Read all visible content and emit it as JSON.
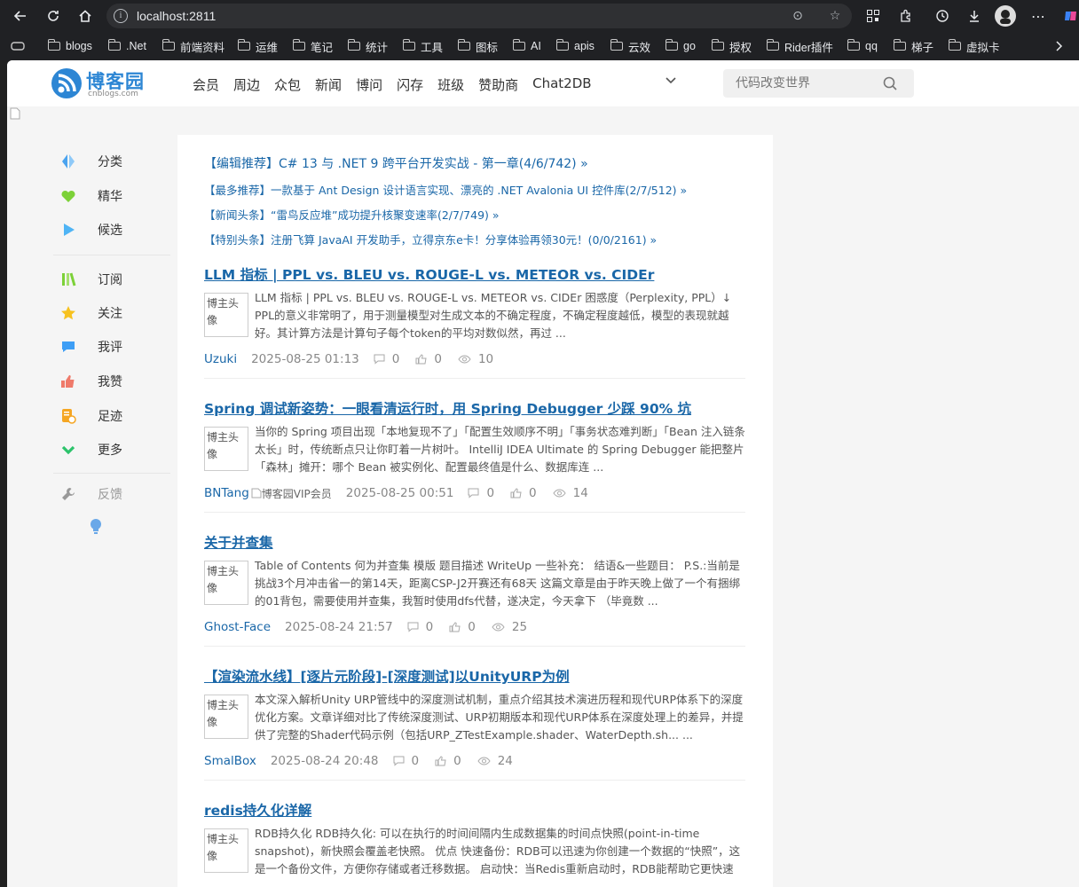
{
  "browser": {
    "url": "localhost:2811",
    "bookmarks": [
      "blogs",
      ".Net",
      "前端资料",
      "运维",
      "笔记",
      "统计",
      "工具",
      "图标",
      "AI",
      "apis",
      "云效",
      "go",
      "授权",
      "Rider插件",
      "qq",
      "梯子",
      "虚拟卡"
    ]
  },
  "site": {
    "logo_text": "博客园",
    "logo_sub": "cnblogs.com",
    "nav": [
      "会员",
      "周边",
      "众包",
      "新闻",
      "博问",
      "闪存",
      "班级",
      "赞助商",
      "Chat2DB"
    ],
    "search_placeholder": "代码改变世界",
    "brand_color": "#2d86d4",
    "link_color": "#1a67a8"
  },
  "sidebar": {
    "group1": [
      {
        "label": "分类",
        "icon": "category-icon"
      },
      {
        "label": "精华",
        "icon": "heart-icon"
      },
      {
        "label": "候选",
        "icon": "play-icon"
      }
    ],
    "group2": [
      {
        "label": "订阅",
        "icon": "subscribe-icon"
      },
      {
        "label": "关注",
        "icon": "star-icon"
      },
      {
        "label": "我评",
        "icon": "comment-icon"
      },
      {
        "label": "我赞",
        "icon": "thumb-icon"
      },
      {
        "label": "足迹",
        "icon": "footprint-icon"
      },
      {
        "label": "更多",
        "icon": "chevron-down-icon"
      }
    ],
    "feedback": "反馈"
  },
  "recommendations": [
    "【编辑推荐】C# 13 与 .NET 9 跨平台开发实战 - 第一章(4/6/742) »",
    "【最多推荐】一款基于 Ant Design 设计语言实现、漂亮的 .NET Avalonia UI 控件库(2/7/512) »",
    "【新闻头条】“雷鸟反应堆”成功提升核聚变速率(2/7/749) »",
    "【特别头条】注册飞算 JavaAI 开发助手，立得京东e卡！分享体验再领30元！(0/0/2161) »"
  ],
  "avatar_alt": "博主头像",
  "posts": [
    {
      "title": "LLM 指标 | PPL vs. BLEU vs. ROUGE-L vs. METEOR vs. CIDEr",
      "summary": "LLM 指标 | PPL vs. BLEU vs. ROUGE-L vs. METEOR vs. CIDEr 困惑度（Perplexity, PPL）↓ PPL的意义非常明了，用于测量模型对生成文本的不确定程度，不确定程度越低，模型的表现就越好。其计算方法是计算句子每个token的平均对数似然，再过 ...",
      "author": "Uzuki",
      "vip": "",
      "date": "2025-08-25 01:13",
      "comments": "0",
      "likes": "0",
      "views": "10"
    },
    {
      "title": "Spring 调试新姿势：一眼看清运行时，用 Spring Debugger 少踩 90% 坑",
      "summary": "当你的 Spring 项目出现「本地复现不了」「配置生效顺序不明」「事务状态难判断」「Bean 注入链条太长」时，传统断点只让你盯着一片树叶。 IntelliJ IDEA Ultimate 的 Spring Debugger 能把整片「森林」摊开：哪个 Bean 被实例化、配置最终值是什么、数据库连 ...",
      "author": "BNTang",
      "vip": "博客园VIP会员",
      "date": "2025-08-25 00:51",
      "comments": "0",
      "likes": "0",
      "views": "14"
    },
    {
      "title": "关于并查集",
      "summary": "Table of Contents 何为并查集 模版 题目描述 WriteUp 一些补充： 结语&一些题目： P.S.:当前是挑战3个月冲击省一的第14天，距离CSP-J2开赛还有68天 这篇文章是由于昨天晚上做了一个有捆绑的01背包，需要使用并查集，我暂时使用dfs代替，遂决定，今天拿下 （毕竟数 ...",
      "author": "Ghost-Face",
      "vip": "",
      "date": "2025-08-24 21:57",
      "comments": "0",
      "likes": "0",
      "views": "25"
    },
    {
      "title": "【渲染流水线】[逐片元阶段]-[深度测试]以UnityURP为例",
      "summary": "本文深入解析Unity URP管线中的深度测试机制，重点介绍其技术演进历程和现代URP体系下的深度优化方案。文章详细对比了传统深度测试、URP初期版本和现代URP体系在深度处理上的差异，并提供了完整的Shader代码示例（包括URP_ZTestExample.shader、WaterDepth.sh... ...",
      "author": "SmalBox",
      "vip": "",
      "date": "2025-08-24 20:48",
      "comments": "0",
      "likes": "0",
      "views": "24"
    },
    {
      "title": "redis持久化详解",
      "summary": "RDB持久化 RDB持久化: 可以在执行的时间间隔内生成数据集的时间点快照(point-in-time snapshot)，新快照会覆盖老快照。 优点 快速备份：RDB可以迅速为你创建一个数据的“快照”，这是一个备份文件，方便你存储或者迁移数据。 启动快：当Redis重新启动时，RDB能帮助它更快速 ...",
      "author": "",
      "vip": "",
      "date": "",
      "comments": "",
      "likes": "",
      "views": ""
    }
  ]
}
